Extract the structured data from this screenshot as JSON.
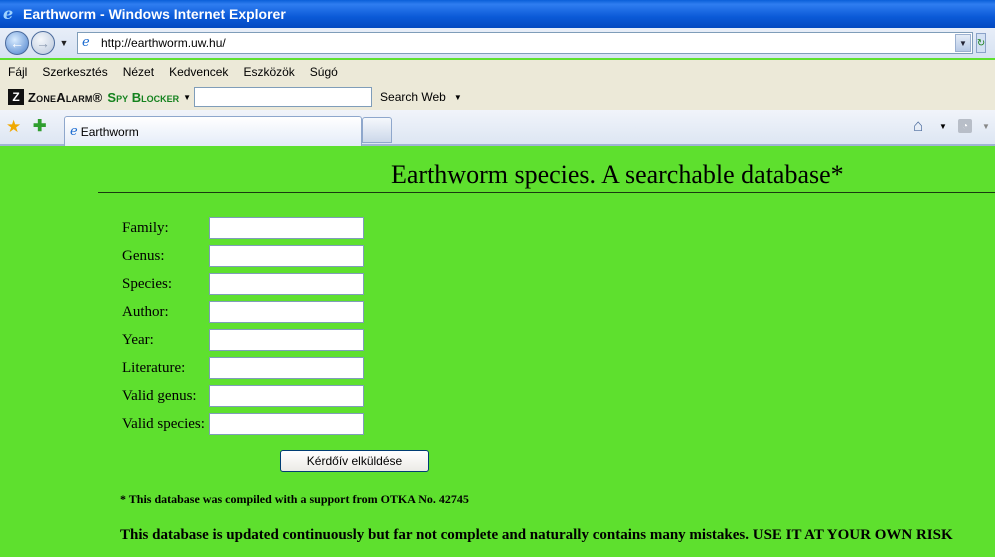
{
  "window": {
    "title": "Earthworm - Windows Internet Explorer"
  },
  "address": {
    "url": "http://earthworm.uw.hu/"
  },
  "menu": {
    "items": [
      "Fájl",
      "Szerkesztés",
      "Nézet",
      "Kedvencek",
      "Eszközök",
      "Súgó"
    ]
  },
  "toolbar": {
    "brand": "ZoneAlarm®",
    "product": "Spy Blocker",
    "search_label": "Search Web"
  },
  "tabs": [
    {
      "label": "Earthworm"
    }
  ],
  "page": {
    "title": "Earthworm species. A searchable database*",
    "fields": [
      {
        "label": "Family:",
        "value": ""
      },
      {
        "label": "Genus:",
        "value": ""
      },
      {
        "label": "Species:",
        "value": ""
      },
      {
        "label": "Author:",
        "value": ""
      },
      {
        "label": "Year:",
        "value": ""
      },
      {
        "label": "Literature:",
        "value": ""
      },
      {
        "label": "Valid genus:",
        "value": ""
      },
      {
        "label": "Valid species:",
        "value": ""
      }
    ],
    "submit_label": "Kérdőív elküldése",
    "footnote": "* This database was compiled with a support from OTKA No. 42745",
    "warning": "This database is updated continuously but far not complete and naturally contains many mistakes. USE IT AT YOUR OWN RISK"
  }
}
